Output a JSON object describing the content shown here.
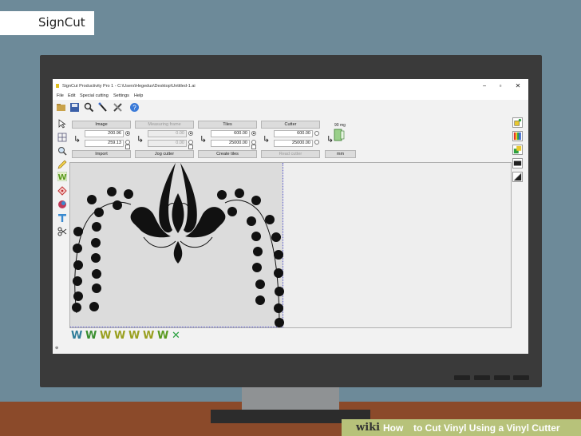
{
  "label": "SignCut",
  "window": {
    "title": "SignCut Productivity Pro 1 - C:\\Users\\Hegedus\\Desktop\\Untitled-1.ai",
    "minimize": "−",
    "maximize": "▫",
    "close": "✕"
  },
  "menu": [
    "File",
    "Edit",
    "Special cutting",
    "Settings",
    "Help"
  ],
  "toolbar_icons": [
    "folder-open-icon",
    "save-icon",
    "zoom-icon",
    "pen-icon",
    "tools-icon",
    "help-icon"
  ],
  "panels": {
    "image": {
      "header": "Image",
      "value1": "200.96",
      "value2": "259.13",
      "action": "Import"
    },
    "measuring": {
      "header": "Measuring frame",
      "value1": "0.00",
      "value2": "0.00",
      "action": "Jog cutter"
    },
    "tiles": {
      "header": "Tiles",
      "value1": "600.00",
      "value2": "25000.00",
      "action": "Create tiles"
    },
    "cutter": {
      "header": "Cutter",
      "value1": "600.00",
      "value2": "25000.00",
      "action": "Read cutter"
    },
    "units": {
      "weight": "90 mg",
      "label": "mm"
    }
  },
  "left_tools": [
    "pointer-icon",
    "grid-icon",
    "magnify-icon",
    "pencil-icon",
    "weed-w-icon",
    "node-icon",
    "color-icon",
    "text-t-icon",
    "scissors-icon"
  ],
  "right_tools": [
    "paint-bucket-icon",
    "color-bars-icon",
    "layers-icon",
    "dark-fill-icon",
    "diagonal-icon"
  ],
  "bottom_icons": [
    "W",
    "W",
    "W",
    "W",
    "W",
    "W",
    "W",
    "✕"
  ],
  "status": "⊕",
  "footer": {
    "wiki": "wiki",
    "how": "How",
    "rest": "to Cut Vinyl Using a Vinyl Cutter"
  }
}
